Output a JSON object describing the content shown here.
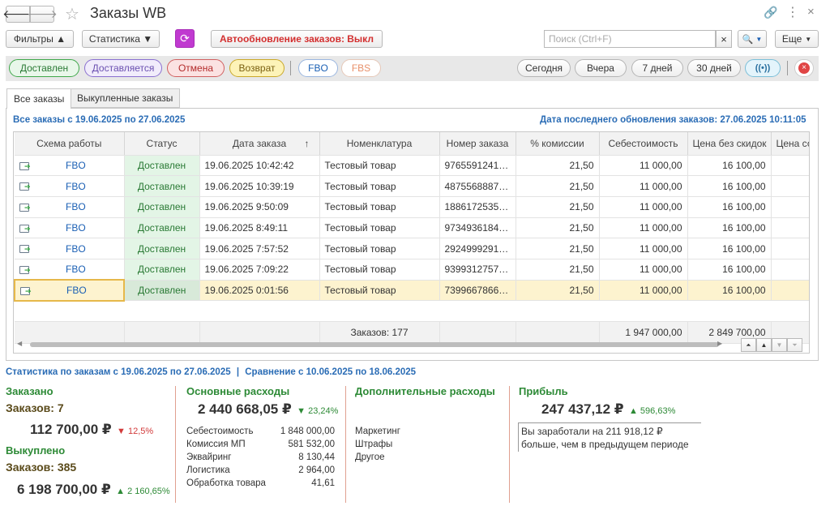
{
  "title": "Заказы WB",
  "toolbar": {
    "filters": "Фильтры ▲",
    "statistics": "Статистика ▼",
    "autoupdate": "Автообновление заказов: Выкл",
    "search_placeholder": "Поиск (Ctrl+F)",
    "more": "Еще",
    "clear": "×",
    "search_btn": "🔍"
  },
  "status_filters": {
    "delivered": "Доставлен",
    "delivering": "Доставляется",
    "cancel": "Отмена",
    "return": "Возврат",
    "fbo": "FBO",
    "fbs": "FBS"
  },
  "period_filters": {
    "today": "Сегодня",
    "yesterday": "Вчера",
    "week": "7 дней",
    "month": "30 дней"
  },
  "tabs": [
    "Все заказы",
    "Выкупленные заказы"
  ],
  "range_label": "Все заказы с 19.06.2025 по 27.06.2025",
  "last_update": "Дата последнего обновления заказов: 27.06.2025 10:11:05",
  "columns": [
    "Схема работы",
    "Статус",
    "Дата заказа",
    "Номенклатура",
    "Номер заказа",
    "% комиссии",
    "Себестоимость",
    "Цена без скидок",
    "Цена со"
  ],
  "sort_indicator": "↑",
  "rows": [
    {
      "scheme": "FBO",
      "status": "Доставлен",
      "date": "19.06.2025 10:42:42",
      "item": "Тестовый товар",
      "number": "9765591241…",
      "commission": "21,50",
      "cost": "11 000,00",
      "price": "16 100,00"
    },
    {
      "scheme": "FBO",
      "status": "Доставлен",
      "date": "19.06.2025 10:39:19",
      "item": "Тестовый товар",
      "number": "4875568887…",
      "commission": "21,50",
      "cost": "11 000,00",
      "price": "16 100,00"
    },
    {
      "scheme": "FBO",
      "status": "Доставлен",
      "date": "19.06.2025 9:50:09",
      "item": "Тестовый товар",
      "number": "1886172535…",
      "commission": "21,50",
      "cost": "11 000,00",
      "price": "16 100,00"
    },
    {
      "scheme": "FBO",
      "status": "Доставлен",
      "date": "19.06.2025 8:49:11",
      "item": "Тестовый товар",
      "number": "9734936184…",
      "commission": "21,50",
      "cost": "11 000,00",
      "price": "16 100,00"
    },
    {
      "scheme": "FBO",
      "status": "Доставлен",
      "date": "19.06.2025 7:57:52",
      "item": "Тестовый товар",
      "number": "2924999291…",
      "commission": "21,50",
      "cost": "11 000,00",
      "price": "16 100,00"
    },
    {
      "scheme": "FBO",
      "status": "Доставлен",
      "date": "19.06.2025 7:09:22",
      "item": "Тестовый товар",
      "number": "9399312757…",
      "commission": "21,50",
      "cost": "11 000,00",
      "price": "16 100,00"
    },
    {
      "scheme": "FBO",
      "status": "Доставлен",
      "date": "19.06.2025 0:01:56",
      "item": "Тестовый товар",
      "number": "7399667866…",
      "commission": "21,50",
      "cost": "11 000,00",
      "price": "16 100,00"
    }
  ],
  "totals": {
    "orders": "Заказов: 177",
    "cost": "1 947 000,00",
    "price": "2 849 700,00"
  },
  "stats": {
    "header": "Статистика по заказам с 19.06.2025 по 27.06.2025",
    "separator": "|",
    "compare": "Сравнение с 10.06.2025 по 18.06.2025",
    "ordered": {
      "title": "Заказано",
      "count": "Заказов: 7",
      "amount": "112 700,00 ₽",
      "delta": "▼ 12,5%"
    },
    "bought": {
      "title": "Выкуплено",
      "count": "Заказов: 385",
      "amount": "6 198 700,00 ₽",
      "delta": "▲ 2 160,65%"
    },
    "main_expenses": {
      "title": "Основные расходы",
      "total": "2 440 668,05 ₽",
      "delta": "▼ 23,24%",
      "items": [
        {
          "label": "Себестоимость",
          "value": "1 848 000,00"
        },
        {
          "label": "Комиссия МП",
          "value": "581 532,00"
        },
        {
          "label": "Эквайринг",
          "value": "8 130,44"
        },
        {
          "label": "Логистика",
          "value": "2 964,00"
        },
        {
          "label": "Обработка товара",
          "value": "41,61"
        }
      ]
    },
    "extra_expenses": {
      "title": "Дополнительные расходы",
      "items": [
        "Маркетинг",
        "Штрафы",
        "Другое"
      ]
    },
    "profit": {
      "title": "Прибыль",
      "total": "247 437,12 ₽",
      "delta": "▲ 596,63%",
      "note_line1": "Вы заработали на 211 918,12 ₽",
      "note_line2": "больше, чем в предыдущем периоде"
    }
  }
}
